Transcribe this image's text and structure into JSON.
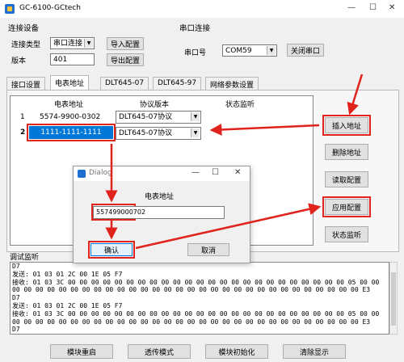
{
  "window": {
    "title": "GC-6100-GCtech",
    "minimize": "—",
    "maximize": "☐",
    "close": "✕"
  },
  "connect_section": {
    "title": "连接设备",
    "conn_type_label": "连接类型",
    "conn_type_value": "串口连接",
    "version_label": "版本",
    "version_value": "401",
    "import_btn": "导入配置",
    "export_btn": "导出配置"
  },
  "serial_section": {
    "title": "串口连接",
    "port_label": "串口号",
    "port_value": "COM59",
    "close_btn": "关闭串口"
  },
  "tabs": [
    "接口设置",
    "电表地址",
    "DLT645-07",
    "DLT645-97",
    "网络参数设置"
  ],
  "table": {
    "headers": [
      "电表地址",
      "协议版本",
      "状态监听"
    ],
    "rows": [
      {
        "num": "1",
        "addr": "5574-9900-0302",
        "proto": "DLT645-07协议"
      },
      {
        "num": "2",
        "addr": "1111-1111-1111",
        "proto": "DLT645-07协议"
      }
    ]
  },
  "side_buttons": {
    "insert": "插入地址",
    "delete": "删除地址",
    "read": "读取配置",
    "apply": "应用配置",
    "status": "状态监听"
  },
  "dialog": {
    "title": "Dialog",
    "field_label": "电表地址",
    "field_value": "557499000702",
    "ok": "确认",
    "cancel": "取消",
    "min": "—",
    "max": "☐",
    "close": "✕"
  },
  "log": {
    "title": "调试监听",
    "lines": [
      "D7",
      "发送: 01 03 01 2C 00 1E 05 F7",
      "接收: 01 03 3C 00 00 00 00 00 00 00 00 00 00 00 00 00 00 00 00 00 00 00 00 00 00 00 00 05 00 00",
      "00 00 00 00 00 00 00 00 00 00 00 00 00 00 00 00 00 00 00 00 00 00 00 00 00 00 00 00 00 00 E3",
      "D7",
      "发送: 01 03 01 2C 00 1E 05 F7",
      "接收: 01 03 3C 00 00 00 00 00 00 00 00 00 00 00 00 00 00 00 00 00 00 00 00 00 00 00 00 05 00 00",
      "00 00 00 00 00 00 00 00 00 00 00 00 00 00 00 00 00 00 00 00 00 00 00 00 00 00 00 00 00 00 E3",
      "D7"
    ]
  },
  "bottom_buttons": {
    "restart": "模块重启",
    "transparent": "透传模式",
    "init": "模块初始化",
    "clear": "清除显示"
  },
  "colors": {
    "highlight_red": "#e0231c",
    "selected_cell": "#0078d7"
  }
}
